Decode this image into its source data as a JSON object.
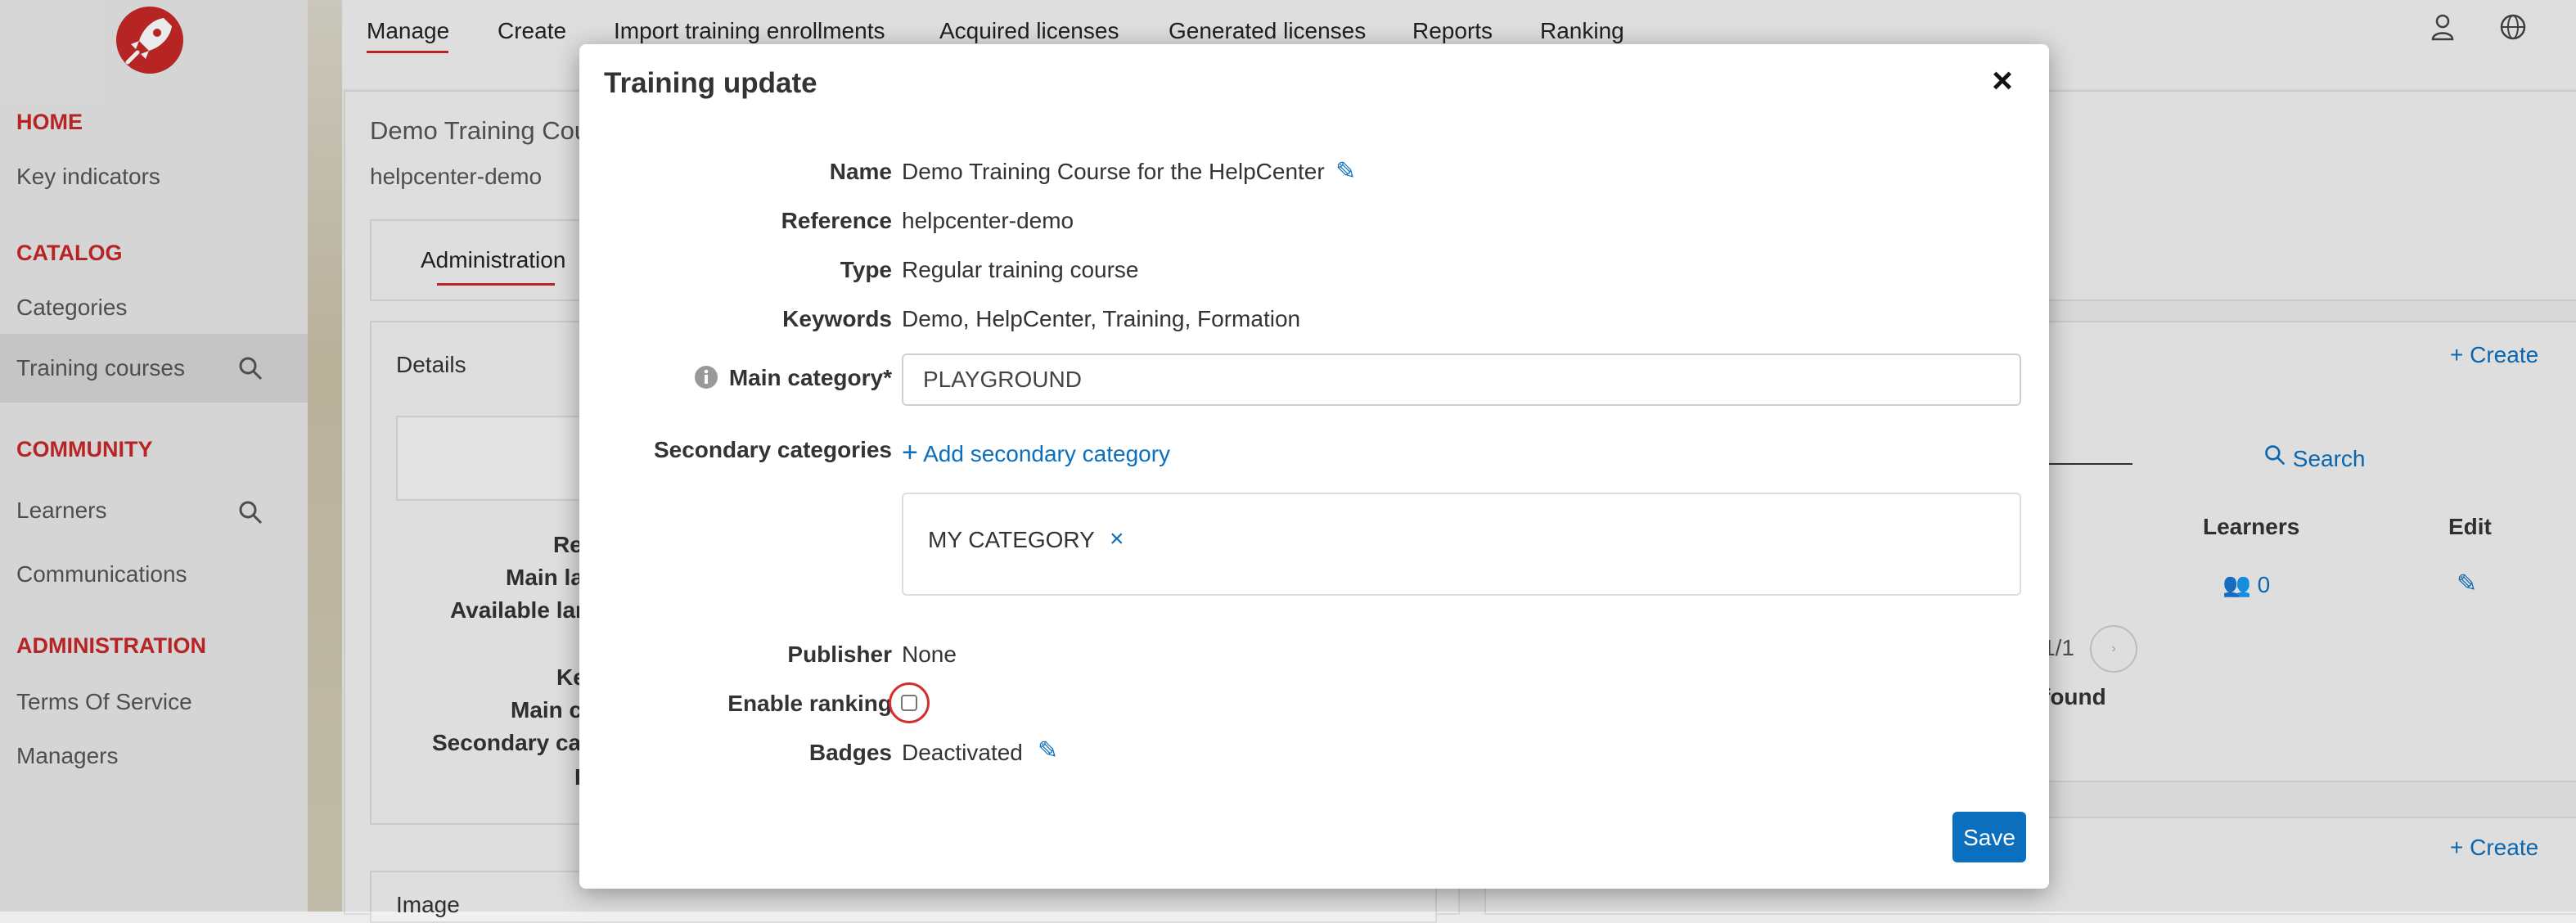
{
  "sidebar": {
    "sections": [
      {
        "title": "HOME",
        "items": [
          "Key indicators"
        ]
      },
      {
        "title": "CATALOG",
        "items": [
          "Categories",
          "Training courses"
        ]
      },
      {
        "title": "COMMUNITY",
        "items": [
          "Learners",
          "Communications"
        ]
      },
      {
        "title": "ADMINISTRATION",
        "items": [
          "Terms Of Service",
          "Managers"
        ]
      }
    ]
  },
  "topnav": {
    "items": [
      "Manage",
      "Create",
      "Import training enrollments",
      "Acquired licenses",
      "Generated licenses",
      "Reports",
      "Ranking"
    ]
  },
  "background": {
    "course_title": "Demo Training Cou",
    "course_ref": "helpcenter-demo",
    "tab_admin": "Administration",
    "details_title": "Details",
    "image_title": "Image",
    "partial_labels": [
      "Re",
      "Main la",
      "Available lan",
      "Ke",
      "Main c",
      "Secondary cat",
      "F"
    ],
    "create_label": "Create",
    "search_label": "Search",
    "select_partial": "s",
    "col_learners": "Learners",
    "col_edit": "Edit",
    "learners_count": "0",
    "pagination": "1/1",
    "found_text": "found"
  },
  "modal": {
    "title": "Training update",
    "fields": {
      "name_label": "Name",
      "name_value": "Demo Training Course for the HelpCenter",
      "reference_label": "Reference",
      "reference_value": "helpcenter-demo",
      "type_label": "Type",
      "type_value": "Regular training course",
      "keywords_label": "Keywords",
      "keywords_value": "Demo, HelpCenter, Training, Formation",
      "main_category_label": "Main category*",
      "main_category_value": "PLAYGROUND",
      "secondary_label": "Secondary categories",
      "add_secondary": "Add secondary category",
      "secondary_chip": "MY CATEGORY",
      "publisher_label": "Publisher",
      "publisher_value": "None",
      "ranking_label": "Enable ranking",
      "ranking_enabled": false,
      "badges_label": "Badges",
      "badges_value": "Deactivated"
    },
    "save_label": "Save"
  },
  "colors": {
    "brand_red": "#c62828",
    "link_blue": "#0b6fbd",
    "highlight_circle": "#d32f2f"
  }
}
